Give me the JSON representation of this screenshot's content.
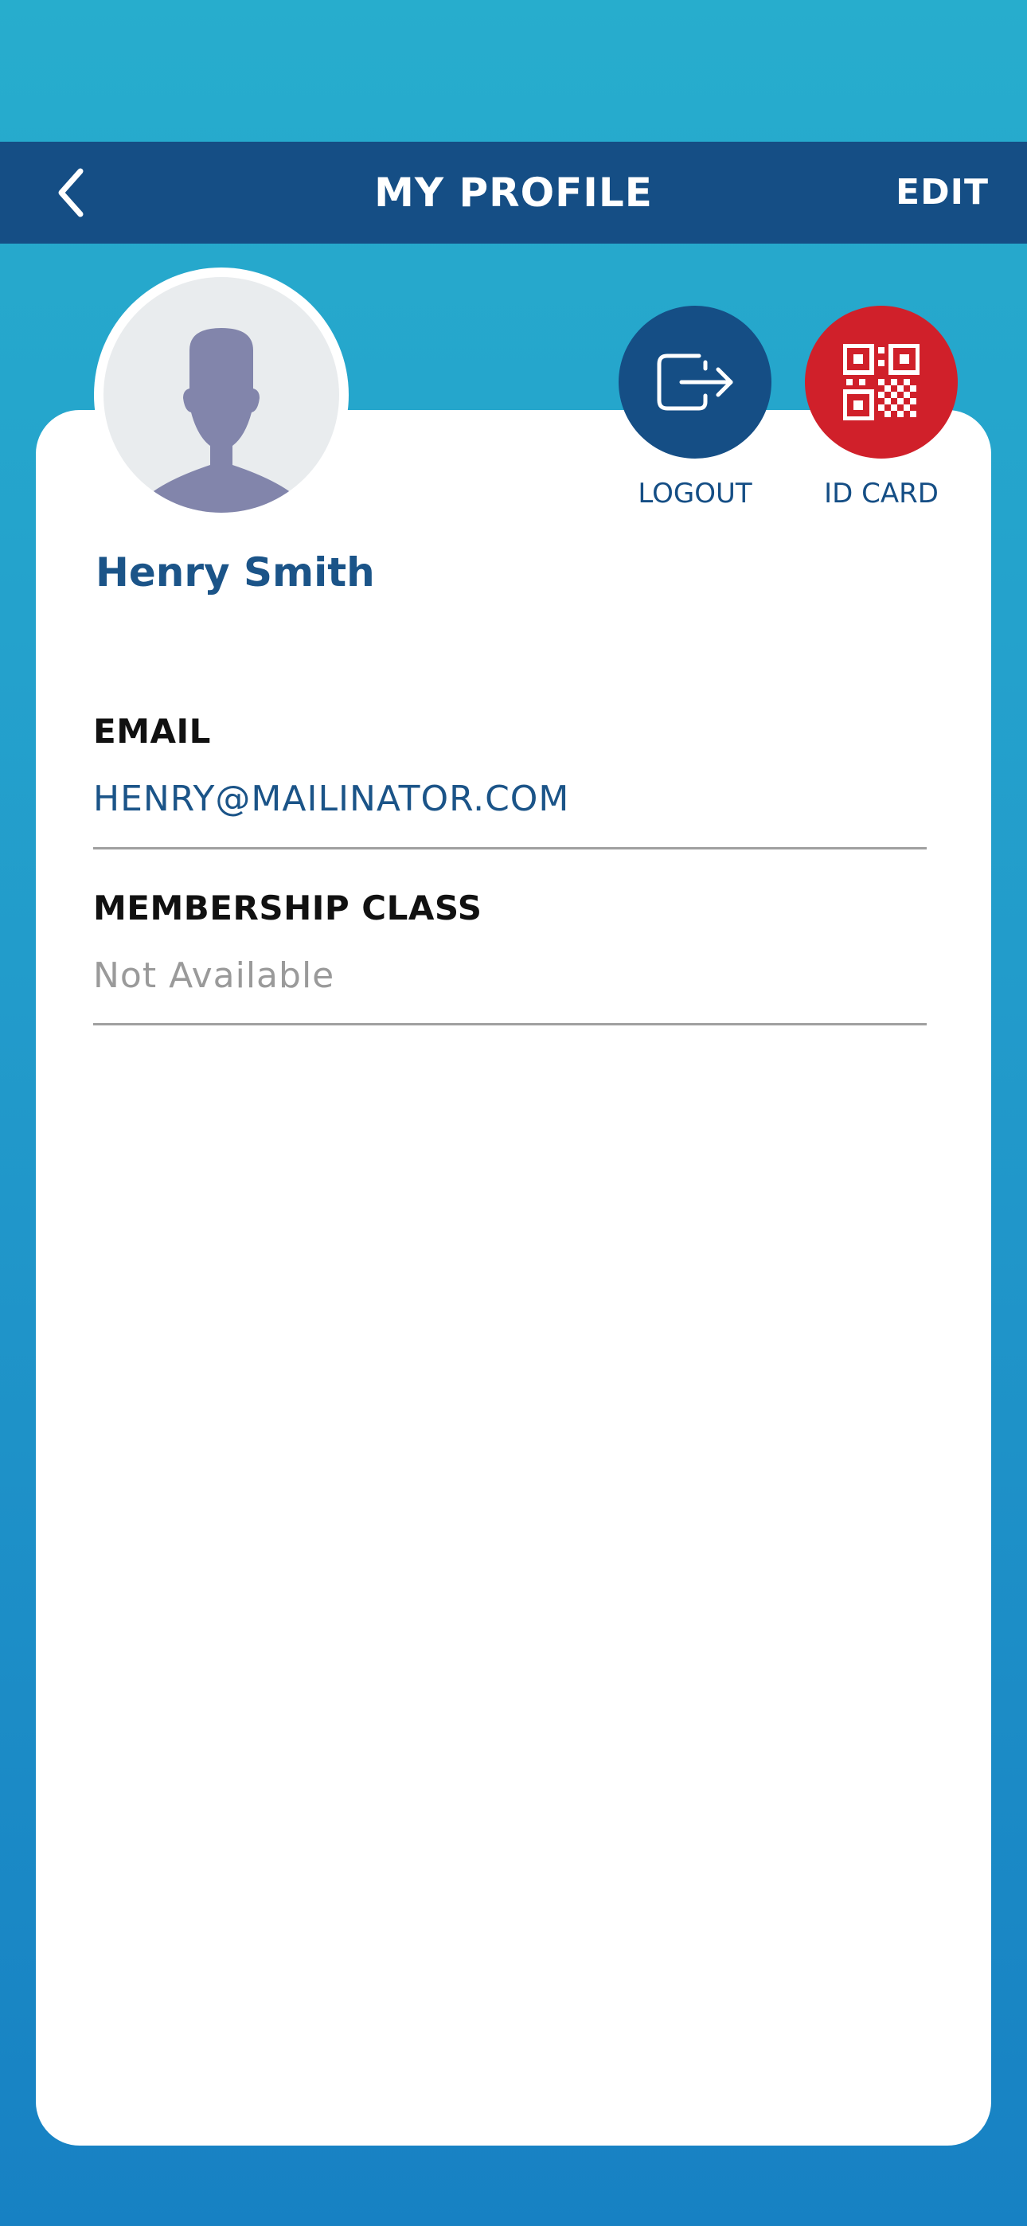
{
  "header": {
    "title": "MY PROFILE",
    "edit_label": "EDIT",
    "back_icon": "chevron-left-icon"
  },
  "profile": {
    "name": "Henry Smith",
    "avatar_icon": "person-silhouette-icon"
  },
  "actions": {
    "logout_label": "LOGOUT",
    "idcard_label": "ID CARD",
    "logout_icon": "logout-icon",
    "idcard_icon": "qr-code-icon"
  },
  "fields": {
    "email_label": "EMAIL",
    "email_value": "HENRY@MAILINATOR.COM",
    "membership_label": "MEMBERSHIP CLASS",
    "membership_value": "Not Available"
  },
  "colors": {
    "navbar": "#154e85",
    "logout_button": "#154e85",
    "idcard_button": "#d0202a",
    "name_text": "#1b5488",
    "background_top": "#27adcd",
    "background_bottom": "#1781c3"
  }
}
